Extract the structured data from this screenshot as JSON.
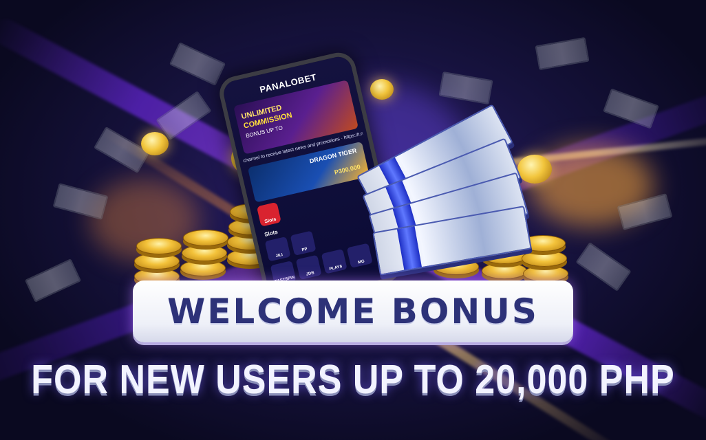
{
  "banner": {
    "headline": "WELCOME BONUS",
    "subheadline": "FOR NEW USERS UP TO 20,000 PHP"
  },
  "phone": {
    "brand": "PANALOBET",
    "promo_line1": "UNLIMITED",
    "promo_line2": "COMMISSION",
    "promo_line3": "BONUS UP TO",
    "ticker": "channel to receive latest news and promotions · https://t.me",
    "promo2_line1": "DRAGON TIGER",
    "promo2_line2": "P300,000",
    "slots_button": "Slots",
    "slots_heading": "Slots",
    "games": [
      "JILI",
      "PP",
      "FASTSPIN",
      "JDB",
      "PLAY8",
      "MG"
    ]
  },
  "colors": {
    "background": "#0b0a24",
    "headline_text": "#2d3278",
    "accent_purple": "#7b2cff",
    "gold": "#f3c23a"
  }
}
